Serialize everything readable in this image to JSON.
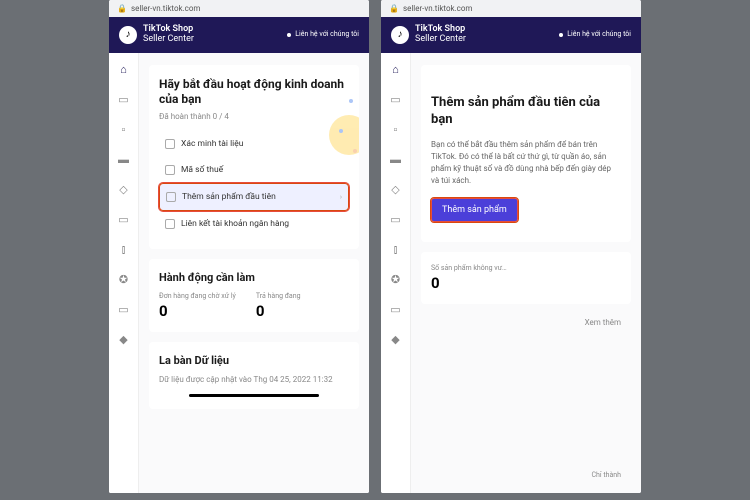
{
  "url": "seller-vn.tiktok.com",
  "brand": {
    "l1": "TikTok Shop",
    "l2": "Seller Center"
  },
  "hdr_right": "Liên hệ với chúng tôi",
  "left": {
    "title": "Hãy bắt đầu hoạt động kinh doanh của bạn",
    "progress": "Đã hoàn thành 0 / 4",
    "tasks": [
      "Xác minh tài liệu",
      "Mã số thuế",
      "Thêm sản phẩm đầu tiên",
      "Liên kết tài khoản ngân hàng"
    ],
    "todo_title": "Hành động cần làm",
    "metrics": [
      {
        "label": "Đơn hàng đang chờ xử lý",
        "value": "0"
      },
      {
        "label": "Trả hàng đang",
        "value": "0"
      }
    ],
    "data_title": "La bàn Dữ liệu",
    "data_sub": "Dữ liệu được cập nhật vào Thg 04 25, 2022 11:32"
  },
  "right": {
    "title": "Thêm sản phẩm đầu tiên của bạn",
    "desc": "Bạn có thể bắt đầu thêm sản phẩm để bán trên TikTok. Đó có thể là bất cứ thứ gì, từ quần áo, sản phẩm kỹ thuật số và đồ dùng nhà bếp đến giày dép và túi xách.",
    "btn": "Thêm sản phẩm",
    "metrics": [
      {
        "label": "Số sản phẩm không vư…",
        "value": "0"
      }
    ],
    "xem": "Xem thêm",
    "chi": "Chỉ thành"
  }
}
